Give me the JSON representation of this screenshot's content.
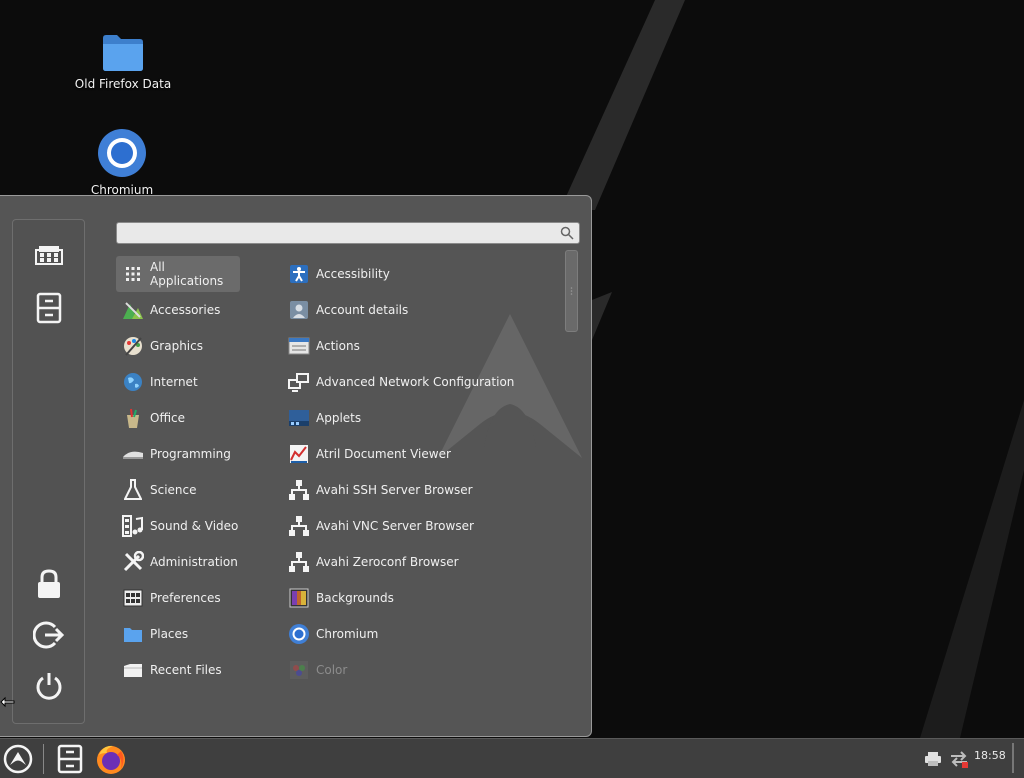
{
  "desktop": {
    "icons": [
      {
        "label": "Old Firefox Data",
        "icon": "folder-icon"
      },
      {
        "label": "Chromium",
        "icon": "chromium-icon"
      }
    ]
  },
  "menu": {
    "search": {
      "value": "",
      "placeholder": ""
    },
    "sidebar": [
      "favorites-icon",
      "file-manager-icon",
      "lock-icon",
      "logout-icon",
      "power-icon"
    ],
    "categories": [
      {
        "label": "All Applications",
        "icon": "grid-icon",
        "active": true
      },
      {
        "label": "Accessories",
        "icon": "accessories-icon"
      },
      {
        "label": "Graphics",
        "icon": "graphics-icon"
      },
      {
        "label": "Internet",
        "icon": "internet-icon"
      },
      {
        "label": "Office",
        "icon": "office-icon"
      },
      {
        "label": "Programming",
        "icon": "programming-icon"
      },
      {
        "label": "Science",
        "icon": "science-icon"
      },
      {
        "label": "Sound & Video",
        "icon": "sound-video-icon"
      },
      {
        "label": "Administration",
        "icon": "administration-icon"
      },
      {
        "label": "Preferences",
        "icon": "preferences-icon"
      },
      {
        "label": "Places",
        "icon": "places-icon"
      },
      {
        "label": "Recent Files",
        "icon": "recent-files-icon"
      }
    ],
    "apps": [
      {
        "label": "Accessibility",
        "icon": "accessibility-icon"
      },
      {
        "label": "Account details",
        "icon": "account-icon"
      },
      {
        "label": "Actions",
        "icon": "actions-icon"
      },
      {
        "label": "Advanced Network Configuration",
        "icon": "network-icon"
      },
      {
        "label": "Applets",
        "icon": "applets-icon"
      },
      {
        "label": "Atril Document Viewer",
        "icon": "document-viewer-icon"
      },
      {
        "label": "Avahi SSH Server Browser",
        "icon": "avahi-icon"
      },
      {
        "label": "Avahi VNC Server Browser",
        "icon": "avahi-icon"
      },
      {
        "label": "Avahi Zeroconf Browser",
        "icon": "avahi-icon"
      },
      {
        "label": "Backgrounds",
        "icon": "backgrounds-icon"
      },
      {
        "label": "Chromium",
        "icon": "chromium-icon"
      },
      {
        "label": "Color",
        "icon": "color-icon",
        "dim": true
      }
    ]
  },
  "panel": {
    "launchers": [
      "menu-icon",
      "file-manager-icon",
      "firefox-icon"
    ],
    "tray": [
      "printer-icon",
      "network-icon"
    ],
    "clock": "18:58"
  },
  "colors": {
    "menu_bg": "#555555",
    "panel_bg": "#3f3f3f",
    "folder_blue": "#4a90d9",
    "chromium_blue": "#4285f4"
  }
}
